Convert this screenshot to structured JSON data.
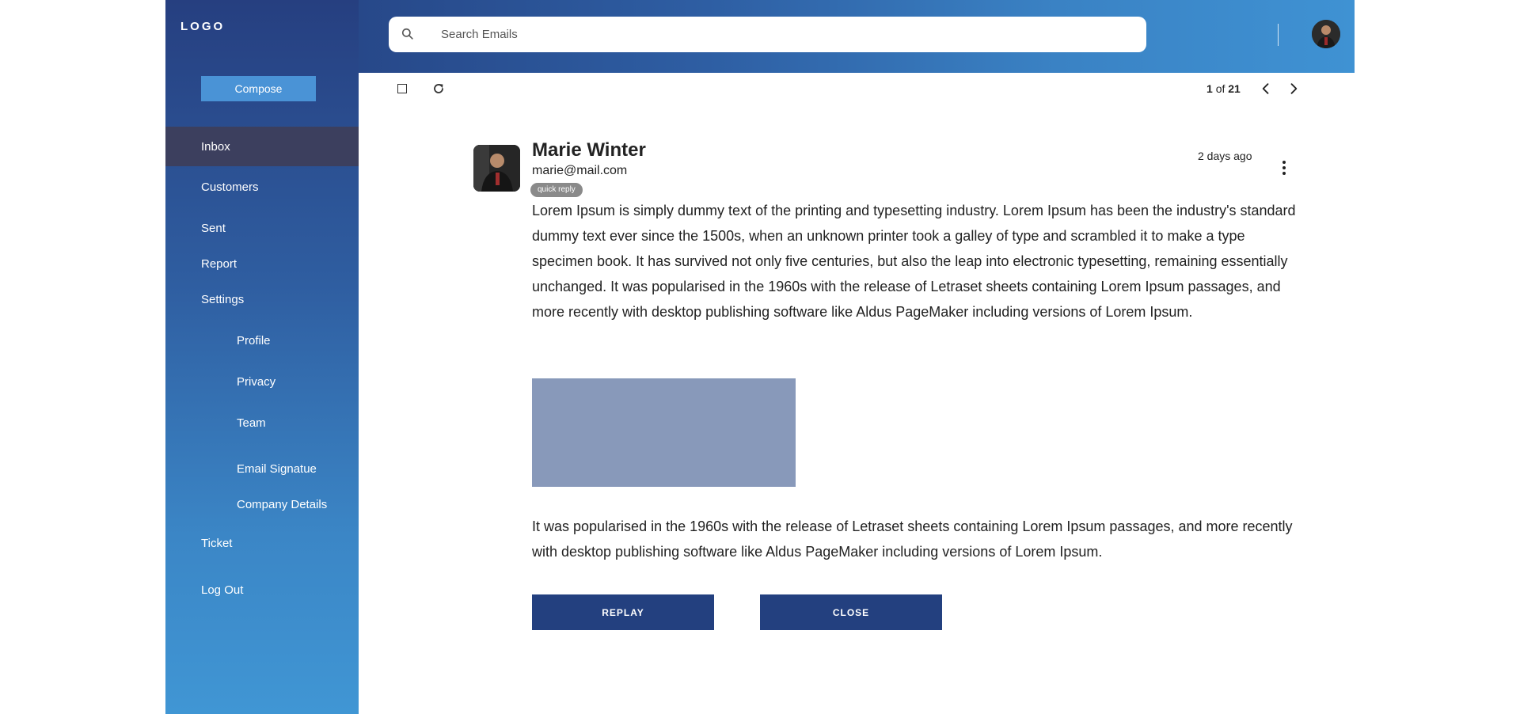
{
  "sidebar": {
    "logo": "LOGO",
    "compose_label": "Compose",
    "items": [
      {
        "label": "Inbox",
        "active": true
      },
      {
        "label": "Customers"
      },
      {
        "label": "Sent"
      },
      {
        "label": "Report"
      },
      {
        "label": "Settings"
      },
      {
        "label": "Profile"
      },
      {
        "label": "Privacy"
      },
      {
        "label": "Team"
      },
      {
        "label": "Email Signatue"
      },
      {
        "label": "Company Details"
      },
      {
        "label": "Ticket"
      },
      {
        "label": "Log Out"
      }
    ]
  },
  "header": {
    "search": {
      "placeholder": "Search Emails",
      "value": ""
    }
  },
  "toolbar": {
    "page_current": "1",
    "page_of": "of",
    "page_total": "21"
  },
  "email": {
    "sender_name": "Marie Winter",
    "sender_email": "marie@mail.com",
    "badge": "quick reply",
    "time": "2 days ago",
    "body_paragraph_1": "Lorem Ipsum is simply dummy text of the printing and typesetting industry. Lorem Ipsum has been the industry's standard dummy text ever since the 1500s, when an unknown printer took a galley of type and scrambled it to make a type specimen book. It has survived not only five centuries, but also the leap into electronic typesetting, remaining essentially unchanged. It was popularised in the 1960s with the release of Letraset sheets containing Lorem Ipsum passages, and more recently with desktop publishing software like Aldus PageMaker including versions of Lorem Ipsum.",
    "body_paragraph_2": "It was popularised in the 1960s with the release of Letraset sheets containing Lorem Ipsum passages, and more recently with desktop publishing software like Aldus PageMaker including versions of Lorem Ipsum.",
    "reply_label": "REPLAY",
    "close_label": "CLOSE"
  },
  "icons": {
    "search": "search-icon",
    "refresh": "refresh-icon",
    "prev": "chevron-left-icon",
    "next": "chevron-right-icon",
    "more": "more-vertical-icon"
  },
  "colors": {
    "sidebar_top": "#263f80",
    "sidebar_bottom": "#4096d4",
    "active_item": "#3c3f5e",
    "compose": "#4a93d6",
    "button": "#23407f",
    "image_placeholder": "#8899ba",
    "badge": "#8a8a8a"
  }
}
